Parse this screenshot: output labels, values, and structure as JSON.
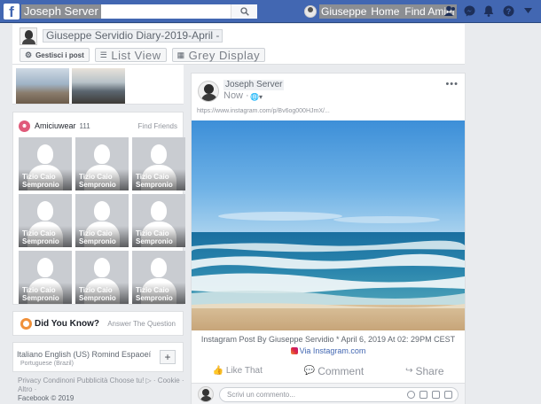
{
  "topbar": {
    "logo": "f",
    "search_text": "Joseph Server",
    "user_name": "Giuseppe",
    "links": [
      "Home",
      "Find Amiel"
    ],
    "icons": [
      "friend-requests-icon",
      "messenger-icon",
      "notifications-icon",
      "help-icon",
      "dropdown-caret-icon"
    ]
  },
  "composer": {
    "title": "Giuseppe Servidio Diary-2019-April -",
    "buttons": {
      "manage": "Gestisci i post",
      "list": "List View",
      "grid": "Grey Display"
    }
  },
  "friends": {
    "title": "Amiciuwear",
    "count": "111",
    "find": "Find Friends",
    "tiles": [
      {
        "name": "Tizio Caio Sempronio"
      },
      {
        "name": "Tizio Caio Sempronio"
      },
      {
        "name": "Tizio Caio Sempronio"
      },
      {
        "name": "Tizio Caio Sempronio"
      },
      {
        "name": "Tizio Caio Sempronio"
      },
      {
        "name": "Tizio Caio Sempronio"
      },
      {
        "name": "Tizio Caio Sempronio"
      },
      {
        "name": "Tizio Caio Sempronio"
      },
      {
        "name": "Tizio Caio Sempronio"
      }
    ]
  },
  "did_you_know": {
    "title": "Did You Know?",
    "link": "Answer The Question"
  },
  "languages": {
    "main": "Italiano English (US) Romind Espaoeí",
    "sub": "Portuguese (Brazil)",
    "add": "+"
  },
  "footer": {
    "links": "Privacy Condinoni Pubblicità Choose tu! ▷ · Cookie · Altro ·",
    "copyright": "Facebook © 2019"
  },
  "post": {
    "author": "Joseph Server",
    "time": "Now ·",
    "url": "https://www.instagram.com/p/Bv6og000HJmX/...",
    "caption": "Instagram Post By Giuseppe Servidio * April 6, 2019 At 02: 29PM CEST",
    "via": "Via Instagram.com",
    "actions": {
      "like": "Like That",
      "comment": "Comment",
      "share": "Share"
    },
    "comment_placeholder": "Scrivi un commento..."
  },
  "colors": {
    "topbar": "#4267b2",
    "page_bg": "#e9ebee",
    "link": "#4267b2"
  }
}
